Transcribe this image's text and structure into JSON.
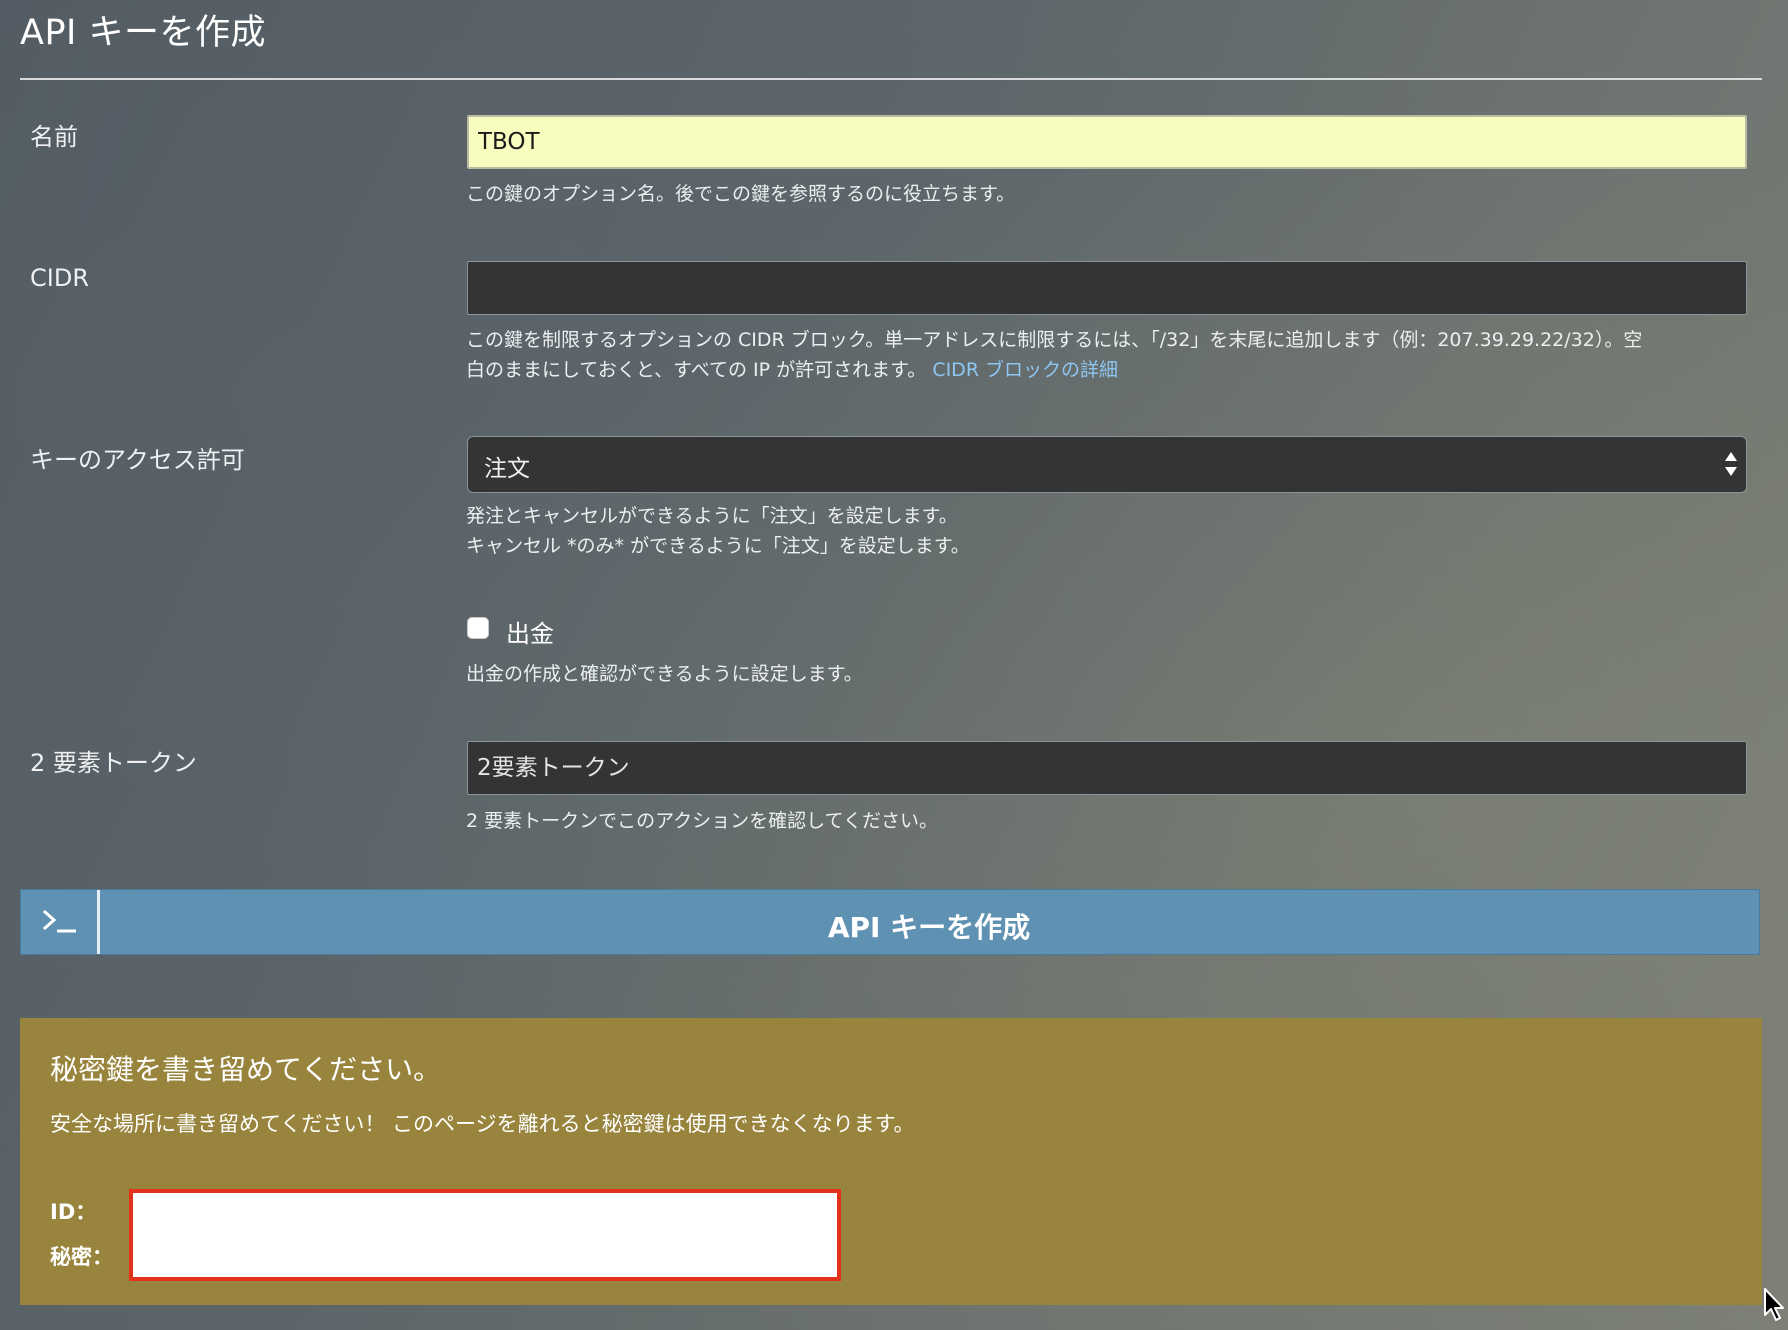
{
  "page": {
    "title": "API キーを作成"
  },
  "form": {
    "name": {
      "label": "名前",
      "value": "TBOT",
      "help": "この鍵のオプション名。後でこの鍵を参照するのに役立ちます。"
    },
    "cidr": {
      "label": "CIDR",
      "value": "",
      "help_line1": "この鍵を制限するオプションの CIDR ブロック。単一アドレスに制限するには、「/32」を末尾に追加します（例：207.39.29.22/32）。空",
      "help_line2": "白のままにしておくと、すべての IP が許可されます。",
      "help_link": "CIDR ブロックの詳細"
    },
    "access": {
      "label": "キーのアクセス許可",
      "selected": "注文",
      "help_line1": "発注とキャンセルができるように「注文」を設定します。",
      "help_line2": "キャンセル *のみ* ができるように「注文」を設定します。"
    },
    "withdraw": {
      "label": "出金",
      "checked": false,
      "help": "出金の作成と確認ができるように設定します。"
    },
    "token": {
      "label": "2 要素トークン",
      "placeholder": "2要素トークン",
      "help": "2 要素トークンでこのアクションを確認してください。"
    },
    "submit": {
      "label": "API キーを作成",
      "icon": "terminal-icon"
    }
  },
  "alert": {
    "title": "秘密鍵を書き留めてください。",
    "text": "安全な場所に書き留めてください！ このページを離れると秘密鍵は使用できなくなります。",
    "id_label": "ID：",
    "secret_label": "秘密：",
    "box_border_color": "#e2321c",
    "background_color": "#99843d"
  },
  "colors": {
    "button": "#5f91b3",
    "name_input_bg": "#f7fcbf",
    "link": "#8fc6f2"
  }
}
